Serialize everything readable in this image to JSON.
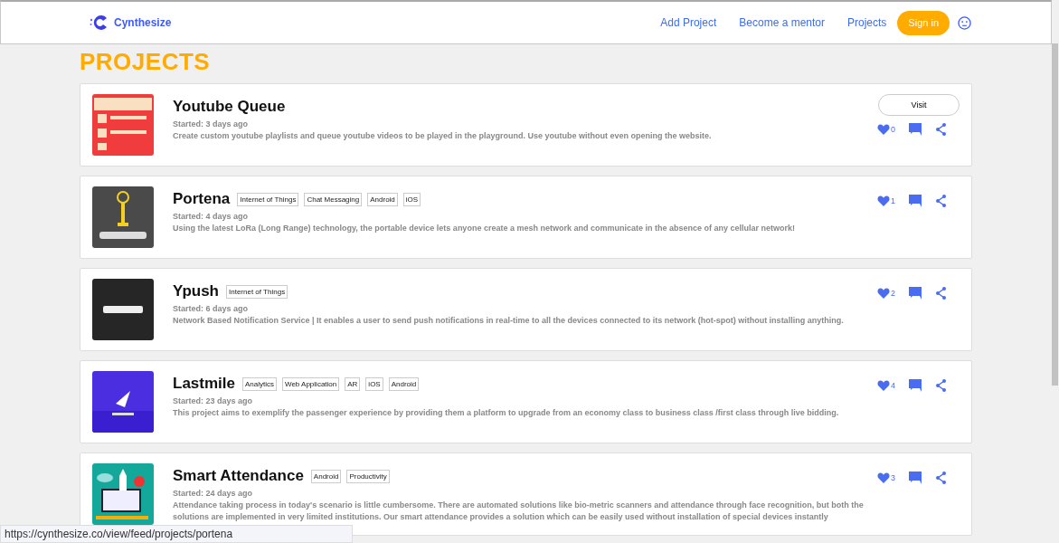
{
  "header": {
    "brand": "Cynthesize",
    "nav": [
      "Add Project",
      "Become a mentor",
      "Projects"
    ],
    "sign_in": "Sign in"
  },
  "page_title": "PROJECTS",
  "projects": [
    {
      "title": "Youtube Queue",
      "started": "Started: 3 days ago",
      "description": "Create custom youtube playlists and queue youtube videos to be played in the playground. Use youtube without even opening the website.",
      "visit": "Visit",
      "likes": "0",
      "thumb": {
        "kind": "picture"
      }
    },
    {
      "title": "Portena",
      "tags": [
        "Internet of Things",
        "Chat Messaging",
        "Android",
        "iOS"
      ],
      "started": "Started: 4 days ago",
      "description": "Using the latest LoRa (Long Range) technology, the portable device lets anyone create a mesh network and communicate in the absence of any cellular network!",
      "likes": "1",
      "thumb": {
        "kind": "picture"
      }
    },
    {
      "title": "Ypush",
      "tags": [
        "Internet of Things"
      ],
      "started": "Started: 6 days ago",
      "description": "Network Based Notification Service | It enables a user to send push notifications in real-time to all the devices connected to its network (hot-spot) without installing anything.",
      "likes": "2",
      "thumb": {
        "kind": "picture"
      }
    },
    {
      "title": "Lastmile",
      "tags": [
        "Analytics",
        "Web Application",
        "AR",
        "iOS",
        "Android"
      ],
      "started": "Started: 23 days ago",
      "description": "This project aims to exemplify the passenger experience by providing them a platform to upgrade from an economy class to business class /first class through live bidding.",
      "likes": "4",
      "thumb": {
        "kind": "picture"
      }
    },
    {
      "title": "Smart Attendance",
      "tags": [
        "Android",
        "Productivity"
      ],
      "started": "Started: 24 days ago",
      "description": "Attendance taking process in today's scenario is little cumbersome. There are automated solutions like bio-metric scanners and attendance through face recognition, but both the solutions are implemented in very limited institutions. Our smart attendance provides a solution which can be easily used without installation of special devices instantly",
      "likes": "3",
      "thumb": {
        "kind": "picture"
      }
    }
  ],
  "status_url": "https://cynthesize.co/view/feed/projects/portena"
}
